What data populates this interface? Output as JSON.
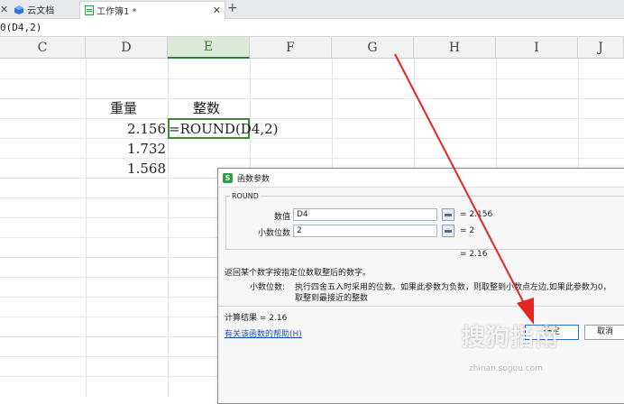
{
  "tabs": {
    "cloud_label": "云文档",
    "book_label": "工作簿1 *"
  },
  "formula_bar": {
    "text": "0(D4,2)"
  },
  "columns": [
    "C",
    "D",
    "E",
    "F",
    "G",
    "H",
    "I",
    "J"
  ],
  "active_column": "E",
  "sheet": {
    "header_weight": "重量",
    "header_integer": "整数",
    "values": [
      "2.156",
      "1.732",
      "1.568"
    ],
    "editing_formula": "=ROUND(D4,2)"
  },
  "dialog": {
    "title": "函数参数",
    "function_name": "ROUND",
    "args": [
      {
        "label": "数值",
        "input": "D4",
        "result": "= 2.156"
      },
      {
        "label": "小数位数",
        "input": "2",
        "result": "= 2"
      }
    ],
    "overall_result": "= 2.16",
    "description": "返回某个数字按指定位数取整后的数字。",
    "param_name": "小数位数:",
    "param_desc_line1": "执行四舍五入时采用的位数。如果此参数为负数，则取整到小数点左边,如果此参数为0，",
    "param_desc_line2": "取整到最接近的整数",
    "calc_result": "计算结果 = 2.16",
    "help_link": "有关该函数的帮助(H)",
    "ok_label": "确定",
    "cancel_label": "取消"
  },
  "watermark": {
    "text": "搜狗指南",
    "url": "zhinan.sogou.com"
  },
  "colors": {
    "annotation": "#e5261f",
    "accent": "#2e7d32"
  }
}
